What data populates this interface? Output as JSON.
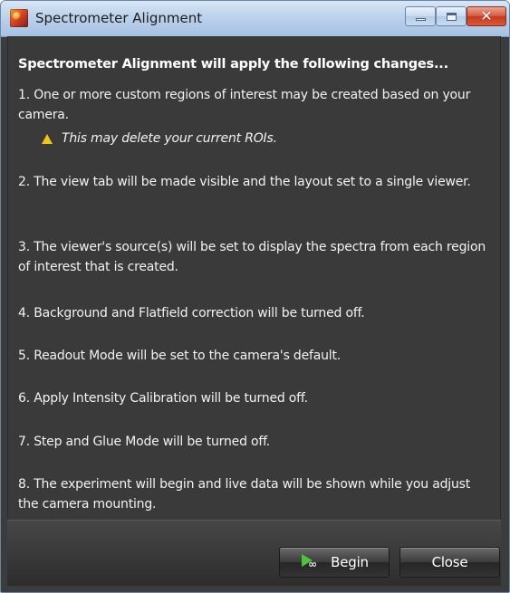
{
  "window": {
    "title": "Spectrometer Alignment",
    "controls": {
      "minimize_icon": "minimize-icon",
      "maximize_icon": "maximize-icon",
      "close_glyph": "✕"
    }
  },
  "dialog": {
    "heading": "Spectrometer Alignment will apply the following changes...",
    "items": [
      "1. One or more custom regions of interest may be created based on your camera.",
      "2. The view tab will be made visible and the layout set to a single viewer.",
      "3. The viewer's source(s) will be set to display the spectra from each region of interest that is created.",
      "4. Background and Flatfield correction will be turned off.",
      "5. Readout Mode will be set to the camera's default.",
      "6. Apply Intensity Calibration will be turned off.",
      "7. Step and Glue Mode will be turned off.",
      "8. The experiment will begin and live data will be shown while you adjust the camera mounting."
    ],
    "warning": "This may delete your current ROIs."
  },
  "buttons": {
    "begin": "Begin",
    "close": "Close",
    "begin_icon_glyph": "∞"
  },
  "colors": {
    "panel_bg": "#3a3a3a",
    "warning_icon": "#f0c419",
    "begin_arrow": "#4fc23c"
  }
}
